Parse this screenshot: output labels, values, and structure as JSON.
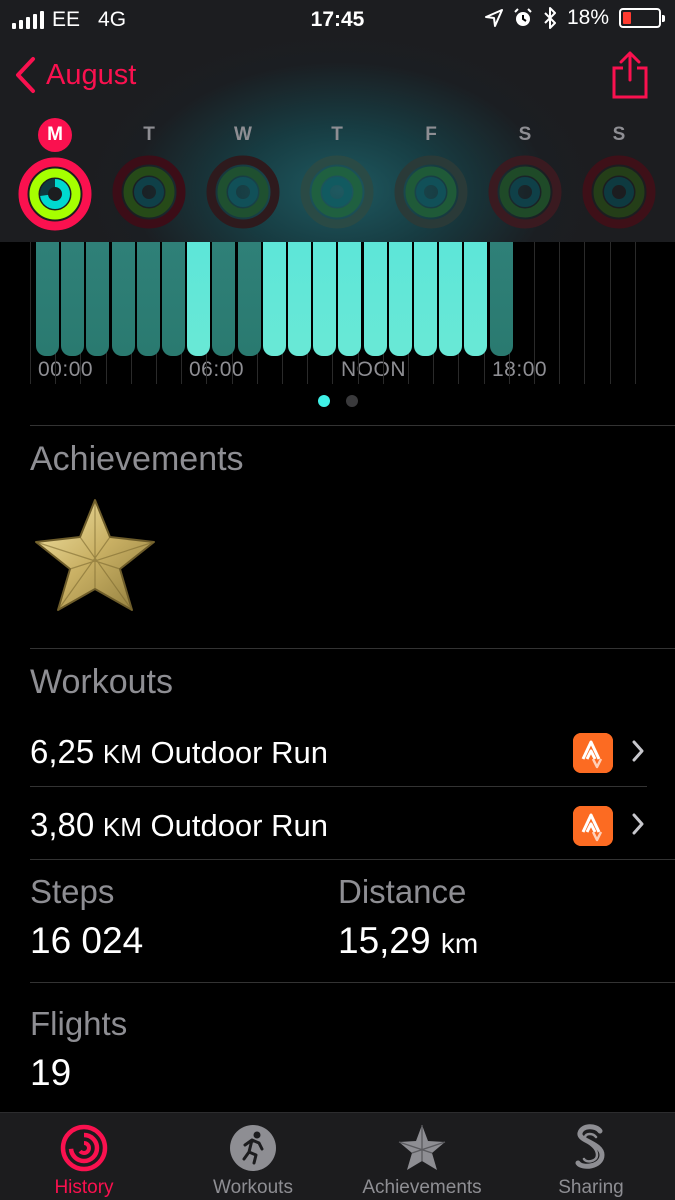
{
  "status_bar": {
    "carrier": "EE",
    "network": "4G",
    "time": "17:45",
    "battery": "18%",
    "battery_level": 0.18
  },
  "nav": {
    "back_label": "August"
  },
  "week": {
    "days": [
      "M",
      "T",
      "W",
      "T",
      "F",
      "S",
      "S"
    ],
    "selected_index": 0
  },
  "hourly_chart": {
    "axis_labels": [
      "00:00",
      "06:00",
      "NOON",
      "18:00"
    ],
    "page_indicator": {
      "pages": 2,
      "current": 0
    }
  },
  "achievements": {
    "title": "Achievements",
    "badge_icon": "gold-star-badge"
  },
  "workouts": {
    "title": "Workouts",
    "items": [
      {
        "distance": "6,25",
        "unit": "KM",
        "type": "Outdoor Run",
        "app_icon": "strava-icon"
      },
      {
        "distance": "3,80",
        "unit": "KM",
        "type": "Outdoor Run",
        "app_icon": "strava-icon"
      }
    ]
  },
  "stats": {
    "steps_label": "Steps",
    "steps_value": "16 024",
    "distance_label": "Distance",
    "distance_value": "15,29",
    "distance_unit": "km",
    "flights_label": "Flights",
    "flights_value": "19"
  },
  "tabbar": {
    "tabs": [
      {
        "label": "History",
        "icon": "history-rings-icon",
        "active": true
      },
      {
        "label": "Workouts",
        "icon": "running-figure-icon",
        "active": false
      },
      {
        "label": "Achievements",
        "icon": "star-icon",
        "active": false
      },
      {
        "label": "Sharing",
        "icon": "sharing-icon",
        "active": false
      }
    ]
  },
  "colors": {
    "accent": "#fa114f",
    "chart_teal": "#5de6d8",
    "chart_teal_dark": "#2a7a70",
    "background": "#000000",
    "secondary_text": "#8e8e93",
    "strava_orange": "#fc6b22"
  }
}
